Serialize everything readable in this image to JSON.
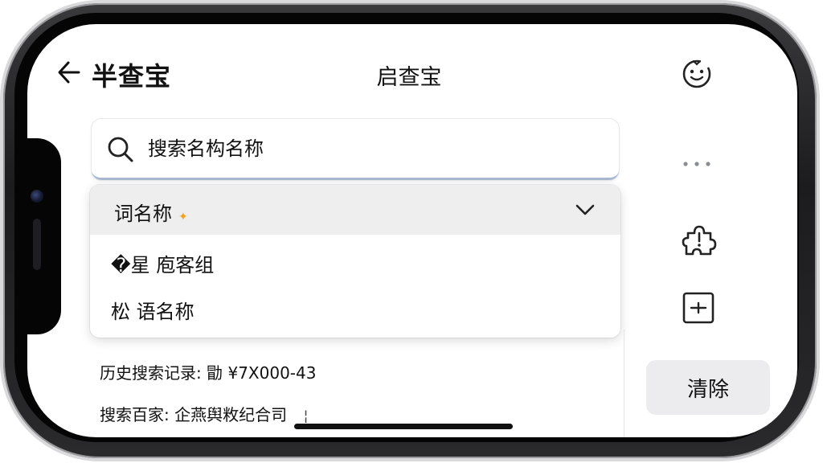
{
  "header": {
    "app_title": "半查宝",
    "center_title": "启查宝"
  },
  "search": {
    "placeholder": "搜索名构名称"
  },
  "dropdown": {
    "selected_label": "词名称",
    "options": [
      {
        "label": "�星 庖客组"
      },
      {
        "label": "松 语名称"
      }
    ]
  },
  "history": {
    "recent_label": "历史搜索记录:",
    "recent_value": "勖 ¥7X000-43",
    "suggest_label": "搜索百家:",
    "suggest_value": "企燕舆敉纪合司",
    "cursor": "¦"
  },
  "actions": {
    "clear_label": "清除"
  },
  "icons": {
    "back": "arrow-left-icon",
    "search": "search-icon",
    "chevron": "chevron-down-icon",
    "smile": "smile-icon",
    "more": "more-horizontal-icon",
    "puzzle": "puzzle-icon",
    "box": "box-minus-icon"
  },
  "colors": {
    "accent_underline": "#a7b8d0",
    "star": "#f2a019",
    "dropdown_header_bg": "#eeeeef",
    "clear_button_bg": "#ececee"
  }
}
